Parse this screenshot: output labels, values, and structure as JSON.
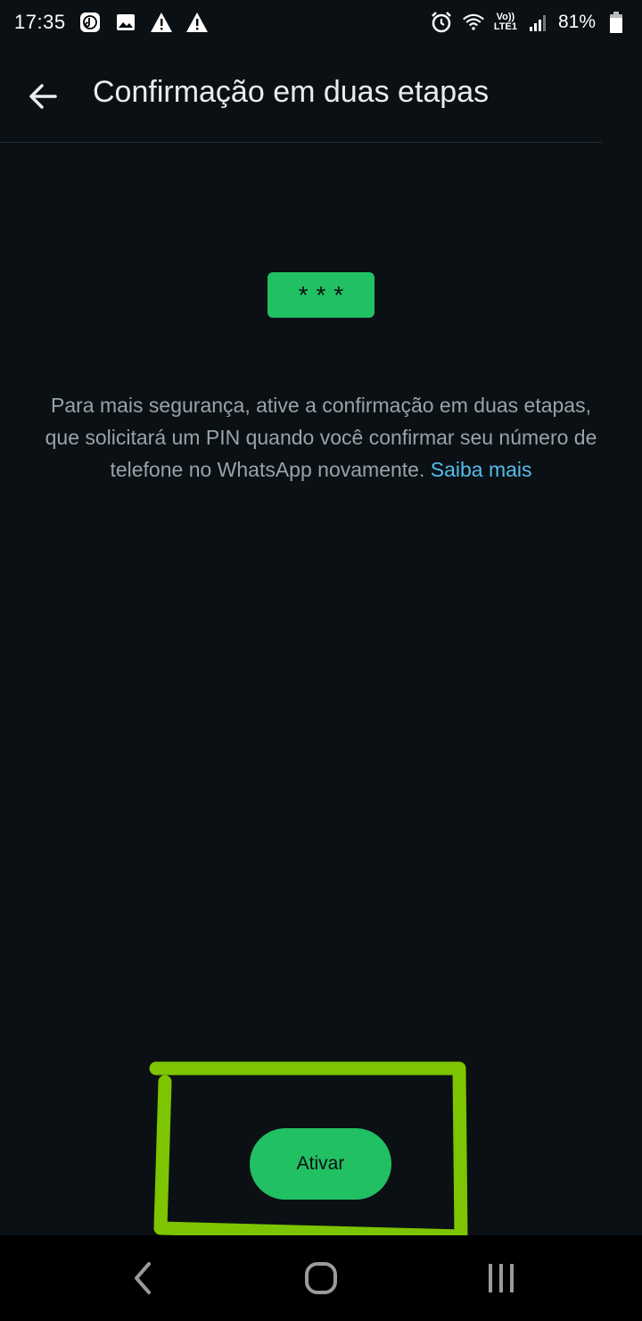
{
  "status_bar": {
    "time": "17:35",
    "volte_top": "Vo))",
    "volte_bottom": "LTE1",
    "battery": "81%",
    "left_icons": [
      "music-note-icon",
      "image-icon",
      "warning-icon",
      "warning-icon"
    ],
    "right_icons": [
      "alarm-icon",
      "wifi-icon",
      "signal-icon",
      "battery-icon"
    ]
  },
  "header": {
    "title": "Confirmação em duas etapas",
    "back_icon": "arrow-left-icon"
  },
  "pin_badge": {
    "text": "***"
  },
  "description": {
    "text": "Para mais segurança, ative a confirmação em duas etapas, que solicitará um PIN quando você confirmar seu número de telefone no WhatsApp novamente.",
    "link": "Saiba mais"
  },
  "actions": {
    "activate_label": "Ativar"
  },
  "nav_bar": {
    "items": [
      "back-nav-icon",
      "home-nav-icon",
      "recents-nav-icon"
    ]
  },
  "colors": {
    "background": "#0b1014",
    "accent_green": "#21c063",
    "link_blue": "#53bdeb",
    "annotation_green": "#7dc500"
  }
}
